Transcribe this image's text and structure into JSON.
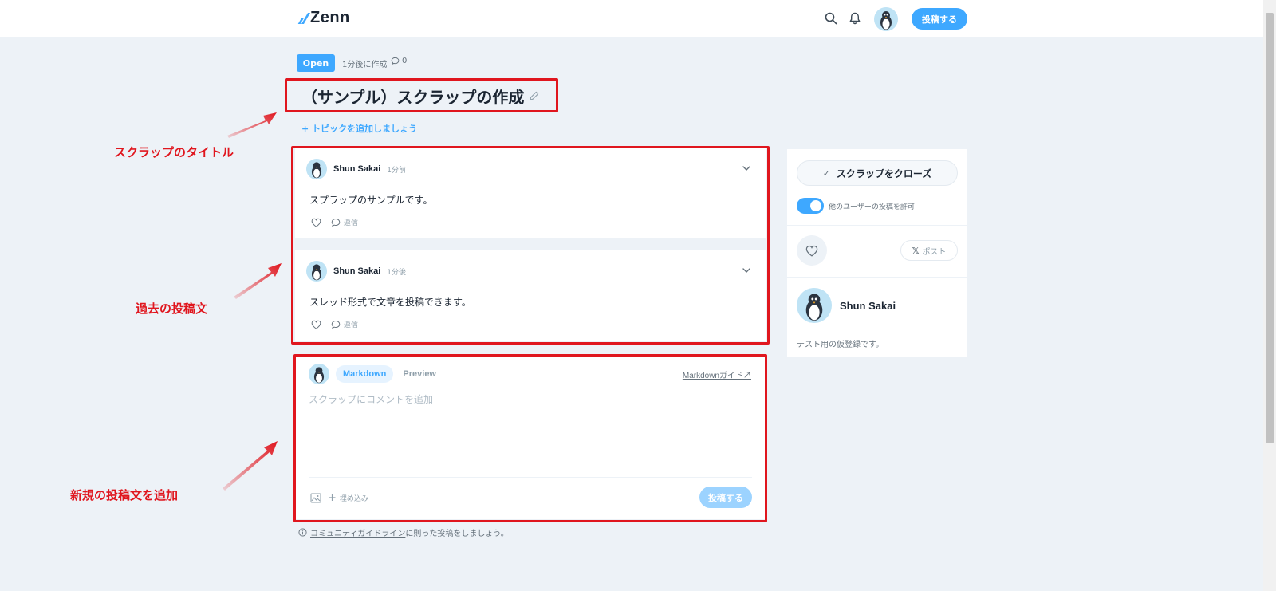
{
  "header": {
    "logo_text": "Zenn",
    "post_button": "投稿する",
    "icons": [
      "search-icon",
      "bell-icon"
    ]
  },
  "scrap": {
    "status_badge": "Open",
    "created": "1分後に作成",
    "comment_count": "0",
    "title": "（サンプル）スクラップの作成",
    "add_topic": "トピックを追加しましょう"
  },
  "posts": [
    {
      "author": "Shun Sakai",
      "time": "1分前",
      "body": "スプラップのサンプルです。",
      "reply_label": "返信"
    },
    {
      "author": "Shun Sakai",
      "time": "1分後",
      "body": "スレッド形式で文章を投稿できます。",
      "reply_label": "返信"
    }
  ],
  "composer": {
    "tab_markdown": "Markdown",
    "tab_preview": "Preview",
    "markdown_guide": "Markdownガイド",
    "placeholder": "スクラップにコメントを追加",
    "embed_label": "埋め込み",
    "submit_label": "投稿する"
  },
  "guideline": {
    "link_text": "コミュニティガイドライン",
    "rest_text": "に則った投稿をしましょう。"
  },
  "sidebar": {
    "close_button": "スクラップをクローズ",
    "toggle_label": "他のユーザーの投稿を許可",
    "toggle_on": true,
    "x_post_label": "ポスト",
    "profile_name": "Shun Sakai",
    "profile_bio": "テスト用の仮登録です。"
  },
  "annotations": {
    "title_label": "スクラップのタイトル",
    "past_posts_label": "過去の投稿文",
    "new_post_label": "新規の投稿文を追加"
  },
  "colors": {
    "accent": "#3ea8ff",
    "annotation": "#e0161e",
    "background": "#edf2f7"
  }
}
